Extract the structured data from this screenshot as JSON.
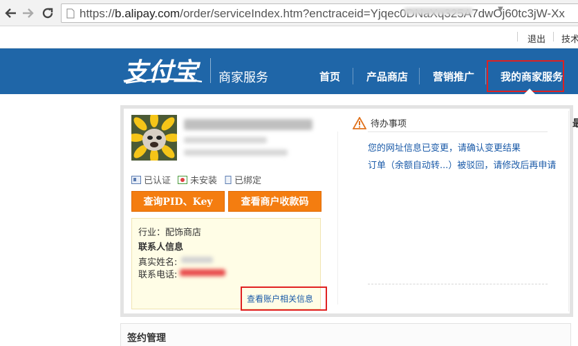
{
  "browser": {
    "url_prefix": "https://",
    "url_host": "b.alipay.com",
    "url_rest": "/order/serviceIndex.htm?enctraceid=Yjqec0DNaXq325A7dwOj60tc3jW-Xx"
  },
  "user_strip": {
    "logout": "退出",
    "tech": "技术"
  },
  "header": {
    "subtitle": "商家服务",
    "nav": [
      "首页",
      "产品商店",
      "营销推广",
      "我的商家服务"
    ]
  },
  "account": {
    "status": [
      "已认证",
      "未安装",
      "已绑定"
    ],
    "btn_pid": "查询PID、Key",
    "btn_qr": "查看商户收款码",
    "industry": "行业：配饰商店",
    "contact_title": "联系人信息",
    "name_label": "真实姓名:",
    "phone_label": "联系电话:",
    "more_link": "查看账户相关信息"
  },
  "todo": {
    "title": "待办事项",
    "items": [
      "您的网址信息已变更，请确认变更结果",
      "订单（余额自动转...）被驳回，请修改后再申请"
    ]
  },
  "right_fragment": "最",
  "sign": {
    "title": "签约管理"
  },
  "colors": {
    "header": "#1f66a8",
    "orange": "#f47d10",
    "link": "#1a5aa8",
    "highlight": "#e02020"
  }
}
